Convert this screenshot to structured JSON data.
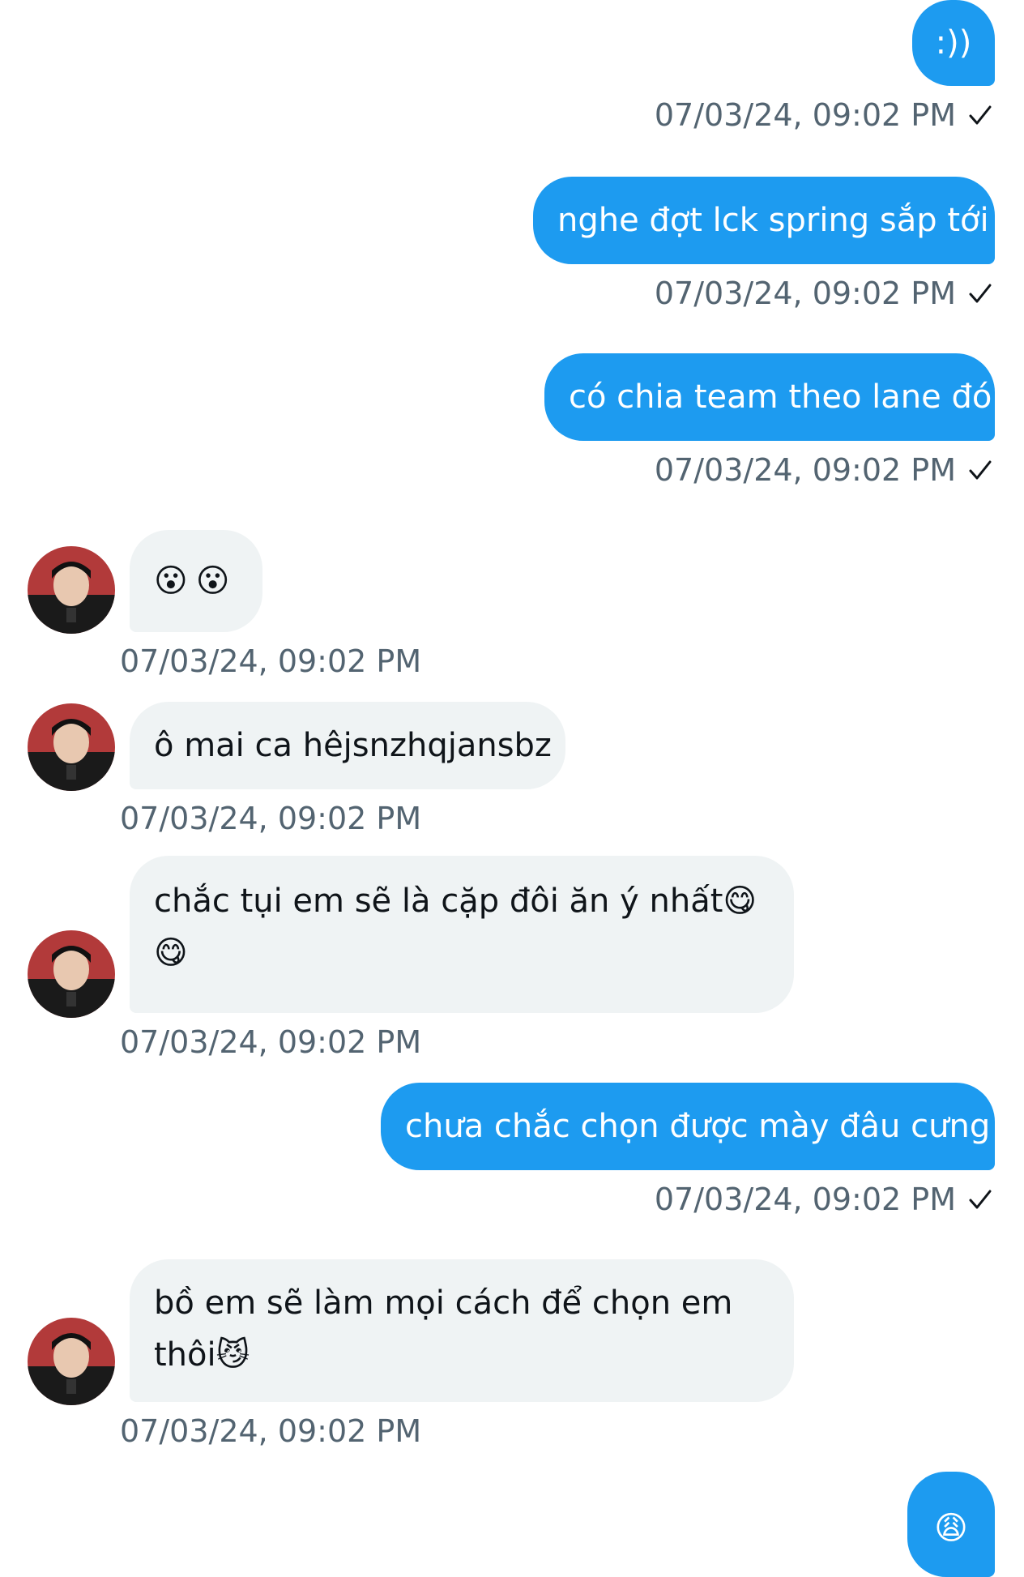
{
  "colors": {
    "sent_bubble": "#1d9bf0",
    "received_bubble": "#eff3f4",
    "timestamp": "#536471"
  },
  "messages": [
    {
      "direction": "sent",
      "text": ":))",
      "timestamp": "07/03/24, 09:02 PM",
      "status_icon": "check-icon"
    },
    {
      "direction": "sent",
      "text": "nghe đợt lck spring sắp tới",
      "timestamp": "07/03/24, 09:02 PM",
      "status_icon": "check-icon"
    },
    {
      "direction": "sent",
      "text": "có chia team theo lane đó",
      "timestamp": "07/03/24, 09:02 PM",
      "status_icon": "check-icon"
    },
    {
      "direction": "received",
      "text": "😮😮",
      "timestamp": "07/03/24, 09:02 PM",
      "avatar_icon": "avatar"
    },
    {
      "direction": "received",
      "text": "ô mai ca hêjsnzhqjansbz",
      "timestamp": "07/03/24, 09:02 PM",
      "avatar_icon": "avatar"
    },
    {
      "direction": "received",
      "text_line1": "chắc tụi em sẽ là cặp đôi ăn ý nhất😋",
      "text_line2": "😋",
      "timestamp": "07/03/24, 09:02 PM",
      "avatar_icon": "avatar"
    },
    {
      "direction": "sent",
      "text": "chưa chắc chọn được mày đâu cưng",
      "timestamp": "07/03/24, 09:02 PM",
      "status_icon": "check-icon"
    },
    {
      "direction": "received",
      "text_line1": "bồ em sẽ làm mọi cách để chọn em",
      "text_line2": "thôi😼",
      "timestamp": "07/03/24, 09:02 PM",
      "avatar_icon": "avatar"
    },
    {
      "direction": "sent",
      "text": "😩"
    }
  ]
}
